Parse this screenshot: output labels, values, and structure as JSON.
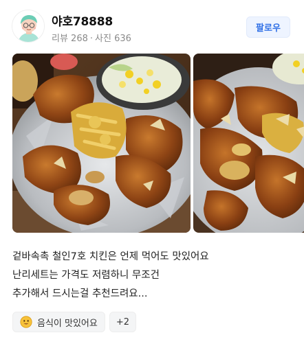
{
  "profile": {
    "username": "야호78888",
    "reviews_label": "리뷰 268",
    "photos_label": "사진 636",
    "avatar_icon": "avatar-character-icon"
  },
  "actions": {
    "follow_label": "팔로우",
    "accent_color": "#2f6fe6"
  },
  "photos": [
    {
      "name": "fried-chicken-platter-photo"
    },
    {
      "name": "fried-chicken-closeup-photo"
    }
  ],
  "review": {
    "lines": [
      "겉바속촉 철인7호 치킨은 언제 먹어도 맛있어요",
      "난리세트는 가격도 저렴하니 무조건",
      "추가해서 드시는걸 추천드려요..."
    ]
  },
  "tags": {
    "items": [
      {
        "icon": "smiley-icon",
        "label": "음식이 맛있어요"
      }
    ],
    "more_label": "+2"
  }
}
